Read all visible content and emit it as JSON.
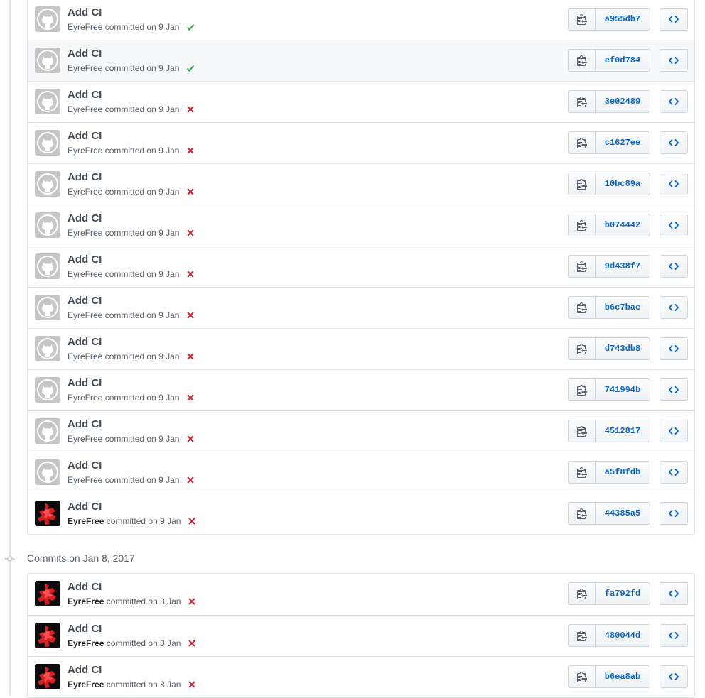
{
  "colors": {
    "link": "#0366d6",
    "success": "#28a745",
    "failure": "#cb2431",
    "border": "#e1e4e8",
    "highlight": "#f6f8fa"
  },
  "icons": {
    "copy": "clippy-icon",
    "browse": "code-icon",
    "success": "check-icon",
    "failure": "x-icon",
    "day_marker": "git-commit-icon"
  },
  "group_jan9": {
    "commits": [
      {
        "title": "Add CI",
        "author": "EyreFree",
        "committed_text": "committed on 9 Jan",
        "sha": "a955db7",
        "status": "success",
        "avatar": "default",
        "author_bold": false,
        "highlighted": false
      },
      {
        "title": "Add CI",
        "author": "EyreFree",
        "committed_text": "committed on 9 Jan",
        "sha": "ef0d784",
        "status": "success",
        "avatar": "default",
        "author_bold": false,
        "highlighted": true
      },
      {
        "title": "Add CI",
        "author": "EyreFree",
        "committed_text": "committed on 9 Jan",
        "sha": "3e02489",
        "status": "failure",
        "avatar": "default",
        "author_bold": false,
        "highlighted": false
      },
      {
        "title": "Add CI",
        "author": "EyreFree",
        "committed_text": "committed on 9 Jan",
        "sha": "c1627ee",
        "status": "failure",
        "avatar": "default",
        "author_bold": false,
        "highlighted": false
      },
      {
        "title": "Add CI",
        "author": "EyreFree",
        "committed_text": "committed on 9 Jan",
        "sha": "10bc89a",
        "status": "failure",
        "avatar": "default",
        "author_bold": false,
        "highlighted": false
      },
      {
        "title": "Add CI",
        "author": "EyreFree",
        "committed_text": "committed on 9 Jan",
        "sha": "b074442",
        "status": "failure",
        "avatar": "default",
        "author_bold": false,
        "highlighted": false
      },
      {
        "title": "Add CI",
        "author": "EyreFree",
        "committed_text": "committed on 9 Jan",
        "sha": "9d438f7",
        "status": "failure",
        "avatar": "default",
        "author_bold": false,
        "highlighted": false
      },
      {
        "title": "Add CI",
        "author": "EyreFree",
        "committed_text": "committed on 9 Jan",
        "sha": "b6c7bac",
        "status": "failure",
        "avatar": "default",
        "author_bold": false,
        "highlighted": false
      },
      {
        "title": "Add CI",
        "author": "EyreFree",
        "committed_text": "committed on 9 Jan",
        "sha": "d743db8",
        "status": "failure",
        "avatar": "default",
        "author_bold": false,
        "highlighted": false
      },
      {
        "title": "Add CI",
        "author": "EyreFree",
        "committed_text": "committed on 9 Jan",
        "sha": "741994b",
        "status": "failure",
        "avatar": "default",
        "author_bold": false,
        "highlighted": false
      },
      {
        "title": "Add CI",
        "author": "EyreFree",
        "committed_text": "committed on 9 Jan",
        "sha": "4512817",
        "status": "failure",
        "avatar": "default",
        "author_bold": false,
        "highlighted": false
      },
      {
        "title": "Add CI",
        "author": "EyreFree",
        "committed_text": "committed on 9 Jan",
        "sha": "a5f8fdb",
        "status": "failure",
        "avatar": "default",
        "author_bold": false,
        "highlighted": false
      },
      {
        "title": "Add CI",
        "author": "EyreFree",
        "committed_text": "committed on 9 Jan",
        "sha": "44385a5",
        "status": "failure",
        "avatar": "custom",
        "author_bold": true,
        "highlighted": false
      }
    ]
  },
  "group_jan8": {
    "heading": "Commits on Jan 8, 2017",
    "commits": [
      {
        "title": "Add CI",
        "author": "EyreFree",
        "committed_text": "committed on 8 Jan",
        "sha": "fa792fd",
        "status": "failure",
        "avatar": "custom",
        "author_bold": true,
        "highlighted": false
      },
      {
        "title": "Add CI",
        "author": "EyreFree",
        "committed_text": "committed on 8 Jan",
        "sha": "480044d",
        "status": "failure",
        "avatar": "custom",
        "author_bold": true,
        "highlighted": false
      },
      {
        "title": "Add CI",
        "author": "EyreFree",
        "committed_text": "committed on 8 Jan",
        "sha": "b6ea8ab",
        "status": "failure",
        "avatar": "custom",
        "author_bold": true,
        "highlighted": false
      }
    ]
  }
}
